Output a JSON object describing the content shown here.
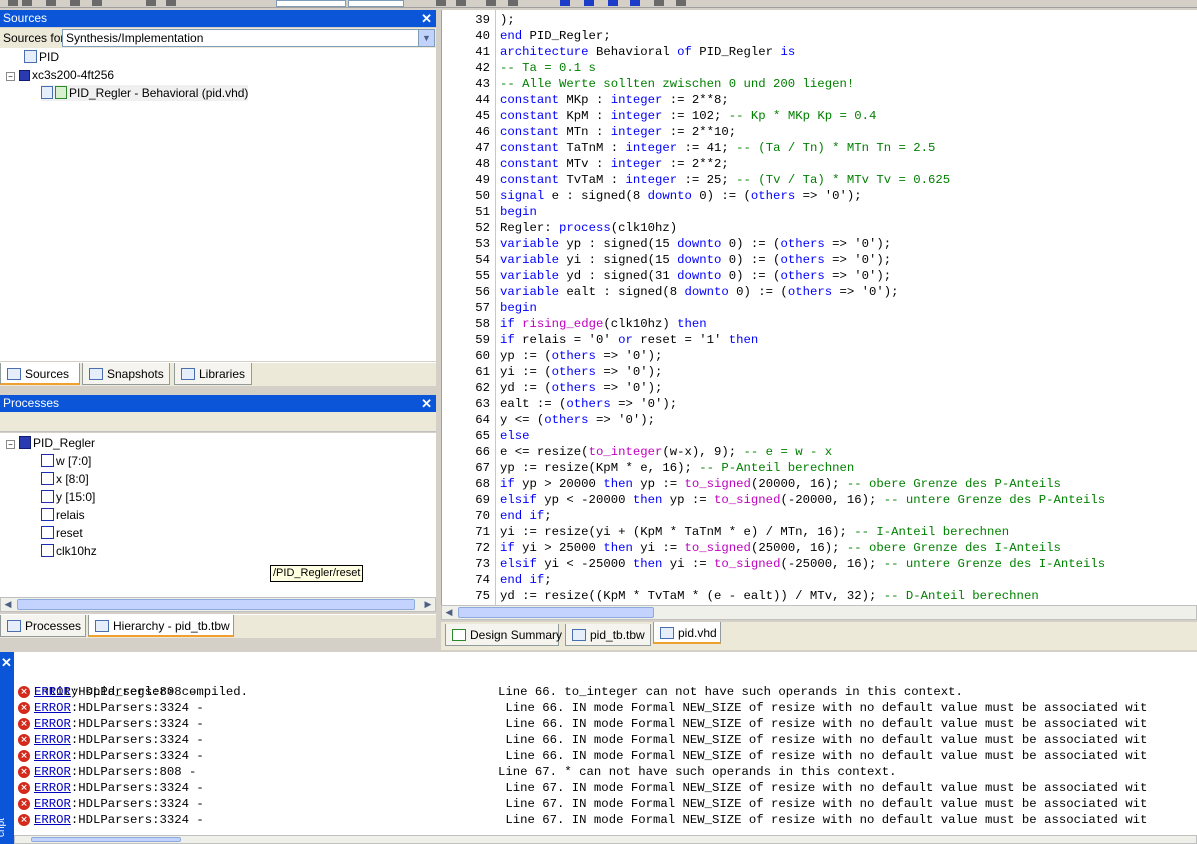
{
  "sources_panel": {
    "title": "Sources",
    "close": "✕",
    "sources_for_label": "Sources for:",
    "sources_for_value": "Synthesis/Implementation",
    "tree": [
      {
        "label": "PID"
      },
      {
        "label": "xc3s200-4ft256"
      },
      {
        "label": "PID_Regler - Behavioral (pid.vhd)"
      }
    ],
    "tabs": [
      "Sources",
      "Snapshots",
      "Libraries"
    ]
  },
  "processes_panel": {
    "title": "Processes",
    "close": "✕",
    "tree": [
      {
        "label": "PID_Regler"
      },
      {
        "label": "w [7:0]"
      },
      {
        "label": "x [8:0]"
      },
      {
        "label": "y [15:0]"
      },
      {
        "label": "relais"
      },
      {
        "label": "reset"
      },
      {
        "label": "clk10hz"
      }
    ],
    "tooltip": "/PID_Regler/reset",
    "tabs": [
      "Processes",
      "Hierarchy - pid_tb.tbw"
    ]
  },
  "editor": {
    "lines": [
      {
        "n": "39",
        "t": ");"
      },
      {
        "n": "40",
        "t": "end PID_Regler;"
      },
      {
        "n": "41",
        "t": "architecture Behavioral of PID_Regler is"
      },
      {
        "n": "42",
        "t": "-- Ta = 0.1 s"
      },
      {
        "n": "43",
        "t": "-- Alle Werte sollten zwischen 0 und 200 liegen!"
      },
      {
        "n": "44",
        "t": "constant MKp : integer := 2**8;"
      },
      {
        "n": "45",
        "t": "constant KpM : integer := 102; -- Kp * MKp Kp = 0.4"
      },
      {
        "n": "46",
        "t": "constant MTn : integer := 2**10;"
      },
      {
        "n": "47",
        "t": "constant TaTnM : integer := 41; -- (Ta / Tn) * MTn Tn = 2.5"
      },
      {
        "n": "48",
        "t": "constant MTv : integer := 2**2;"
      },
      {
        "n": "49",
        "t": "constant TvTaM : integer := 25; -- (Tv / Ta) * MTv Tv = 0.625"
      },
      {
        "n": "50",
        "t": "signal e : signed(8 downto 0) := (others => '0');"
      },
      {
        "n": "51",
        "t": "begin"
      },
      {
        "n": "52",
        "t": "Regler: process(clk10hz)"
      },
      {
        "n": "53",
        "t": "variable yp : signed(15 downto 0) := (others => '0');"
      },
      {
        "n": "54",
        "t": "variable yi : signed(15 downto 0) := (others => '0');"
      },
      {
        "n": "55",
        "t": "variable yd : signed(31 downto 0) := (others => '0');"
      },
      {
        "n": "56",
        "t": "variable ealt : signed(8 downto 0) := (others => '0');"
      },
      {
        "n": "57",
        "t": "begin"
      },
      {
        "n": "58",
        "t": "if rising_edge(clk10hz) then"
      },
      {
        "n": "59",
        "t": "if relais = '0' or reset = '1' then"
      },
      {
        "n": "60",
        "t": "yp := (others => '0');"
      },
      {
        "n": "61",
        "t": "yi := (others => '0');"
      },
      {
        "n": "62",
        "t": "yd := (others => '0');"
      },
      {
        "n": "63",
        "t": "ealt := (others => '0');"
      },
      {
        "n": "64",
        "t": "y <= (others => '0');"
      },
      {
        "n": "65",
        "t": "else"
      },
      {
        "n": "66",
        "t": "e <= resize(to_integer(w-x), 9); -- e = w - x"
      },
      {
        "n": "67",
        "t": "yp := resize(KpM * e, 16); -- P-Anteil berechnen"
      },
      {
        "n": "68",
        "t": "if yp > 20000 then yp := to_signed(20000, 16); -- obere Grenze des P-Anteils"
      },
      {
        "n": "69",
        "t": "elsif yp < -20000 then yp := to_signed(-20000, 16); -- untere Grenze des P-Anteils"
      },
      {
        "n": "70",
        "t": "end if;"
      },
      {
        "n": "71",
        "t": "yi := resize(yi + (KpM * TaTnM * e) / MTn, 16); -- I-Anteil berechnen"
      },
      {
        "n": "72",
        "t": "if yi > 25000 then yi := to_signed(25000, 16); -- obere Grenze des I-Anteils"
      },
      {
        "n": "73",
        "t": "elsif yi < -25000 then yi := to_signed(-25000, 16); -- untere Grenze des I-Anteils"
      },
      {
        "n": "74",
        "t": "end if;"
      },
      {
        "n": "75",
        "t": "yd := resize((KpM * TvTaM * (e - ealt)) / MTv, 32); -- D-Anteil berechnen"
      }
    ],
    "tabs": [
      "Design Summary",
      "pid_tb.tbw",
      "pid.vhd"
    ]
  },
  "console": {
    "first_line": "Entity <pid_regler> compiled.",
    "errors": [
      {
        "label": "ERROR",
        "code": ":HDLParsers:808 -",
        "msg": "Line 66. to_integer can not have such operands in this context."
      },
      {
        "label": "ERROR",
        "code": ":HDLParsers:3324 -",
        "msg": " Line 66. IN mode Formal NEW_SIZE of resize with no default value must be associated wit"
      },
      {
        "label": "ERROR",
        "code": ":HDLParsers:3324 -",
        "msg": " Line 66. IN mode Formal NEW_SIZE of resize with no default value must be associated wit"
      },
      {
        "label": "ERROR",
        "code": ":HDLParsers:3324 -",
        "msg": " Line 66. IN mode Formal NEW_SIZE of resize with no default value must be associated wit"
      },
      {
        "label": "ERROR",
        "code": ":HDLParsers:3324 -",
        "msg": " Line 66. IN mode Formal NEW_SIZE of resize with no default value must be associated wit"
      },
      {
        "label": "ERROR",
        "code": ":HDLParsers:808 -",
        "msg": "Line 67. * can not have such operands in this context."
      },
      {
        "label": "ERROR",
        "code": ":HDLParsers:3324 -",
        "msg": " Line 67. IN mode Formal NEW_SIZE of resize with no default value must be associated wit"
      },
      {
        "label": "ERROR",
        "code": ":HDLParsers:3324 -",
        "msg": " Line 67. IN mode Formal NEW_SIZE of resize with no default value must be associated wit"
      },
      {
        "label": "ERROR",
        "code": ":HDLParsers:3324 -",
        "msg": " Line 67. IN mode Formal NEW_SIZE of resize with no default value must be associated wit"
      }
    ],
    "side_label": "cript"
  },
  "colors": {
    "title_bar": "#0a55d8",
    "keyword": "#0000ff",
    "function": "#c000c0",
    "comment": "#008000",
    "error_icon": "#d42a1c"
  },
  "icons": {
    "close": "close-icon",
    "dropdown": "chevron-down-icon",
    "error": "error-icon"
  }
}
